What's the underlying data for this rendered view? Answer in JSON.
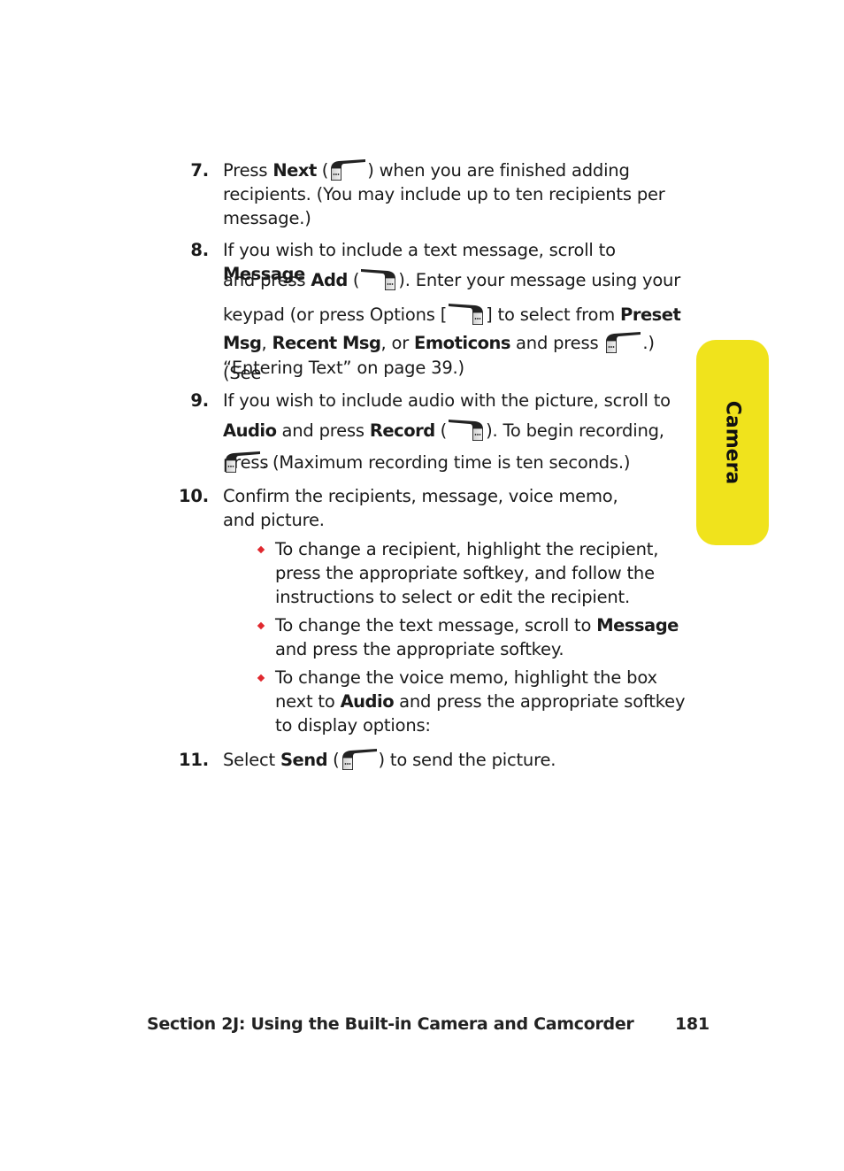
{
  "side_tab": {
    "label": "Camera",
    "color": "#f0e31c"
  },
  "icons": {
    "left_softkey": "left-softkey-icon",
    "right_softkey": "right-softkey-icon",
    "bullet": "red-diamond-bullet"
  },
  "steps": [
    {
      "number": "7.",
      "parts": [
        "Press ",
        "Next",
        " (",
        ") when you are finished adding recipients. (You may include up to ten recipients per message.)"
      ]
    },
    {
      "number": "8.",
      "line1": [
        "If you wish to include a text message, scroll to ",
        "Message"
      ],
      "line2": [
        "and press ",
        "Add",
        " (",
        "). Enter your message using your"
      ],
      "line3": [
        "keypad (or press Options [",
        "] to select from ",
        "Preset"
      ],
      "line4": [
        "Msg",
        ", ",
        "Recent Msg",
        ", or ",
        "Emoticons",
        " and press ",
        ".) (See"
      ],
      "line5": "“Entering Text” on page 39.)"
    },
    {
      "number": "9.",
      "line1": "If you wish to include audio with the picture, scroll to",
      "line2": [
        "Audio",
        " and press ",
        "Record",
        " (",
        "). To begin recording, press"
      ],
      "line3": ". (Maximum recording time is ten seconds.)"
    },
    {
      "number": "10.",
      "text": "Confirm the recipients, message, voice memo, and picture.",
      "bullets": [
        {
          "text": "To change a recipient, highlight the recipient, press the appropriate softkey, and follow the instructions to select or edit the recipient."
        },
        {
          "parts": [
            "To change the text message, scroll to ",
            "Message",
            " and press the appropriate softkey."
          ]
        },
        {
          "parts": [
            "To change the voice memo, highlight the box next to ",
            "Audio",
            " and press the appropriate softkey to display options:"
          ]
        }
      ]
    },
    {
      "number": "11.",
      "parts": [
        "Select ",
        "Send",
        " (",
        ") to send the picture."
      ]
    }
  ],
  "footer": {
    "section": "Section 2J: Using the Built-in Camera and Camcorder",
    "page_number": "181"
  }
}
